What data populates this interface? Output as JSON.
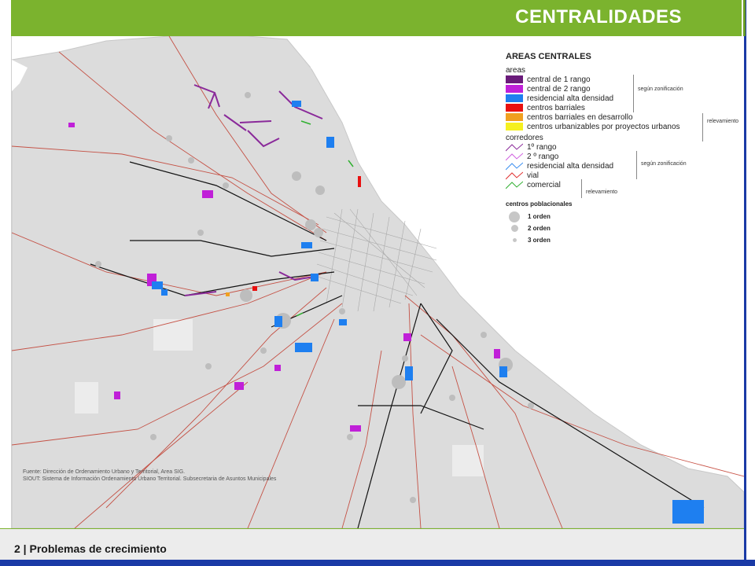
{
  "header": {
    "title": "CENTRALIDADES"
  },
  "footer": {
    "label": "2 | Problemas de crecimiento"
  },
  "source": {
    "line1": "Fuente: Dirección de Ordenamiento Urbano y Territorial, Area SIG.",
    "line2": "SIOUT: Sistema de Información Ordenamiento Urbano Territorial. Subsecretaria de Asuntos Municipales"
  },
  "legend": {
    "title": "AREAS CENTRALES",
    "areas_title": "areas",
    "areas": [
      {
        "label": "central de 1 rango",
        "color": "#6a1b7a"
      },
      {
        "label": "central de 2 rango",
        "color": "#c020d8"
      },
      {
        "label": "residencial alta densidad",
        "color": "#1e7ff0"
      },
      {
        "label": "centros barriales",
        "color": "#e81010"
      },
      {
        "label": "centros barriales en desarrollo",
        "color": "#f0a020"
      },
      {
        "label": "centros urbanizables por proyectos urbanos",
        "color": "#f5f020"
      }
    ],
    "note_zonificacion": "según zonificación",
    "note_relevamiento": "relevamiento",
    "corredores_title": "corredores",
    "corredores": [
      {
        "label": "1º rango",
        "color": "#8a2a9a"
      },
      {
        "label": "2 º rango",
        "color": "#d060e0"
      },
      {
        "label": "residencial alta densidad",
        "color": "#3a8ef0"
      },
      {
        "label": "vial",
        "color": "#e03030"
      },
      {
        "label": "comercial",
        "color": "#30b030"
      }
    ],
    "note_zonificacion2": "según zonificación",
    "note_relevamiento2": "relevamiento",
    "poblacionales_title": "centros poblacionales",
    "poblacionales": [
      {
        "label": "1 orden"
      },
      {
        "label": "2 orden"
      },
      {
        "label": "3 orden"
      }
    ]
  },
  "colors": {
    "accent_green": "#7bb32e",
    "frame_blue": "#1a3aa6",
    "land_gray": "#dcdcdc",
    "road_red": "#c0392b",
    "rail_black": "#111111"
  }
}
